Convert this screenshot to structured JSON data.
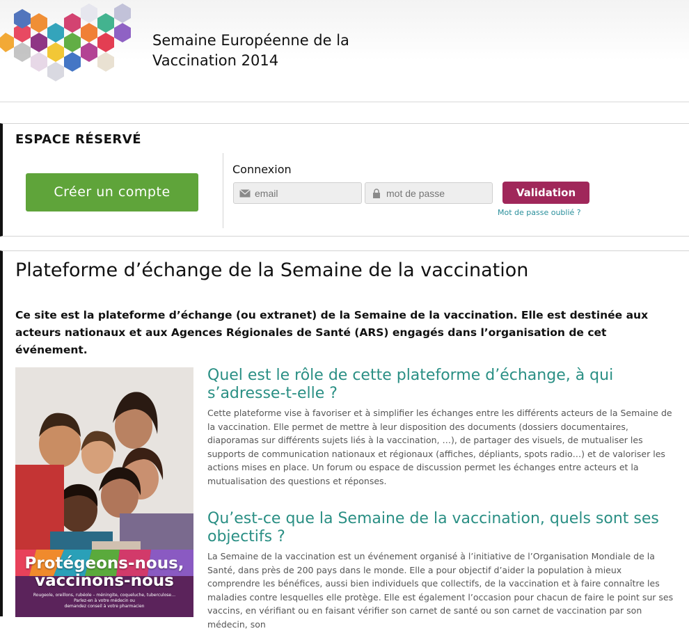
{
  "header": {
    "title_line1": "Semaine Européenne de la",
    "title_line2": "Vaccination 2014"
  },
  "reserved": {
    "title": "ESPACE RÉSERVÉ",
    "create_account": "Créer un compte",
    "connexion_label": "Connexion",
    "email_placeholder": "email",
    "password_placeholder": "mot de passe",
    "submit": "Validation",
    "forgot": "Mot de passe oublié ?"
  },
  "main": {
    "title": "Plateforme d’échange de la Semaine de la vaccination",
    "intro": "Ce site est la plateforme d’échange (ou extranet) de la Semaine de la vaccination. Elle est destinée aux acteurs nationaux et aux Agences Régionales de Santé (ARS) engagés dans l’organisation de cet événement.",
    "poster": {
      "headline1": "Protégeons-nous,",
      "headline2": "vaccinons-nous",
      "small1": "Rougeole, oreillons, rubéole – méningite, coqueluche, tuberculose…",
      "small2": "Parlez-en à votre médecin ou",
      "small3": "demandez conseil à votre pharmacien"
    },
    "sections": [
      {
        "title": "Quel est le rôle de cette plateforme d’échange, à qui s’adresse-t-elle ?",
        "text": "Cette plateforme vise à favoriser et à simplifier les échanges entre les différents acteurs de la Semaine de la vaccination. Elle permet de mettre à leur disposition des documents (dossiers documentaires, diaporamas sur différents sujets liés à la vaccination, …), de partager des visuels, de mutualiser les supports de communication nationaux et régionaux (affiches, dépliants, spots radio…) et de valoriser les actions mises en place. Un forum ou espace de discussion permet les échanges entre acteurs et la mutualisation des questions et réponses."
      },
      {
        "title": "Qu’est-ce que la Semaine de la vaccination, quels sont ses objectifs ?",
        "text": "La Semaine de la vaccination est un événement organisé à l’initiative de l’Organisation Mondiale de la Santé, dans près de 200 pays dans le monde. Elle a pour objectif d’aider la population à mieux comprendre les bénéfices, aussi bien individuels que collectifs, de la vaccination et à faire connaître les maladies contre lesquelles elle protège. Elle est également l’occasion pour chacun de faire le point sur ses vaccins, en vérifiant ou en faisant vérifier son carnet de santé ou son carnet de vaccination par son médecin, son"
      }
    ]
  },
  "colors": {
    "create_button": "#5fa43a",
    "submit_button": "#a0275a",
    "section_title": "#2a8f84",
    "link": "#2a8f9b"
  }
}
